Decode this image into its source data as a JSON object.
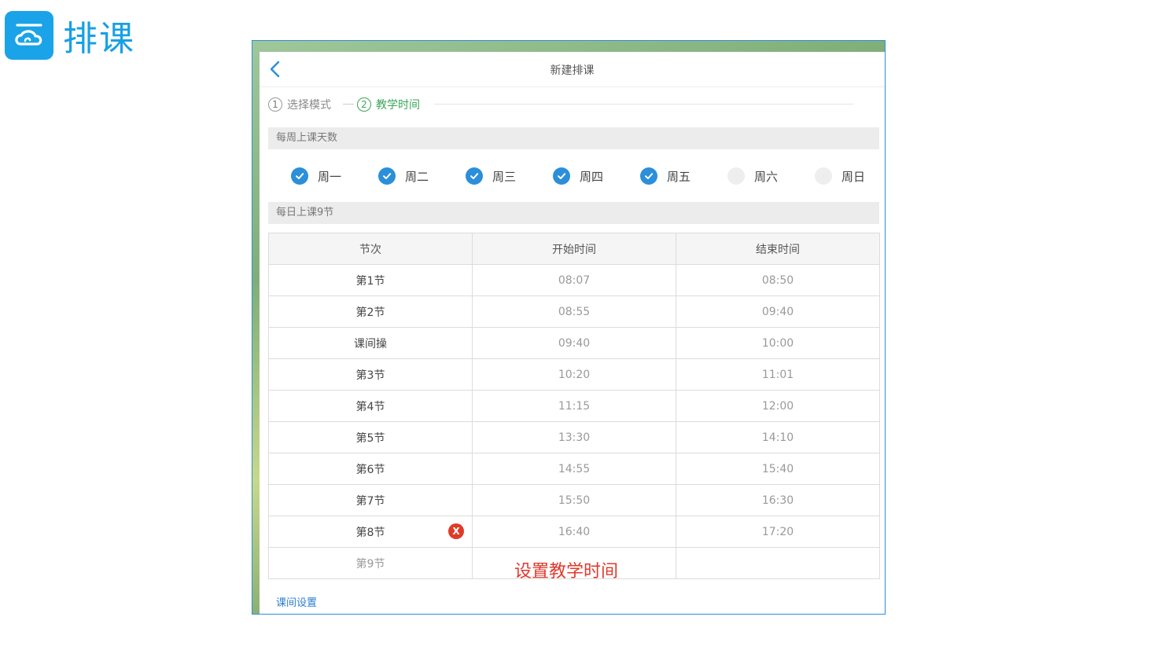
{
  "brand": {
    "title": "排课",
    "accent": "#1aa3e8"
  },
  "header": {
    "title": "新建排课"
  },
  "steps": [
    {
      "num": "1",
      "label": "选择模式"
    },
    {
      "num": "2",
      "label": "教学时间"
    }
  ],
  "week_section": {
    "label": "每周上课天数",
    "days": [
      {
        "label": "周一",
        "checked": true
      },
      {
        "label": "周二",
        "checked": true
      },
      {
        "label": "周三",
        "checked": true
      },
      {
        "label": "周四",
        "checked": true
      },
      {
        "label": "周五",
        "checked": true
      },
      {
        "label": "周六",
        "checked": false
      },
      {
        "label": "周日",
        "checked": false
      }
    ]
  },
  "daily_section": {
    "label": "每日上课9节"
  },
  "table": {
    "headers": [
      "节次",
      "开始时间",
      "结束时间"
    ],
    "rows": [
      {
        "name": "第1节",
        "start": "08:07",
        "end": "08:50"
      },
      {
        "name": "第2节",
        "start": "08:55",
        "end": "09:40"
      },
      {
        "name": "课间操",
        "start": "09:40",
        "end": "10:00"
      },
      {
        "name": "第3节",
        "start": "10:20",
        "end": "11:01"
      },
      {
        "name": "第4节",
        "start": "11:15",
        "end": "12:00"
      },
      {
        "name": "第5节",
        "start": "13:30",
        "end": "14:10"
      },
      {
        "name": "第6节",
        "start": "14:55",
        "end": "15:40"
      },
      {
        "name": "第7节",
        "start": "15:50",
        "end": "16:30"
      },
      {
        "name": "第8节",
        "start": "16:40",
        "end": "17:20",
        "delete_icon": "X"
      },
      {
        "name": "第9节",
        "start": "",
        "end": ""
      }
    ],
    "hint": "设置教学时间"
  },
  "footer": {
    "link": "课间设置"
  }
}
